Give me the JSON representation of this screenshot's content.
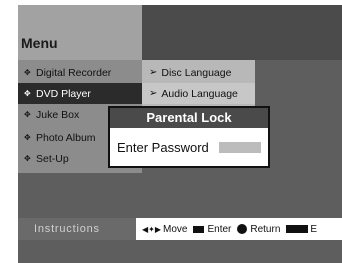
{
  "header": {
    "title": "Menu"
  },
  "menu": {
    "items": [
      {
        "label": "Digital Recorder",
        "active": false
      },
      {
        "label": "DVD Player",
        "active": true
      },
      {
        "label": "Juke Box",
        "active": false
      },
      {
        "label": "Photo Album",
        "active": false
      },
      {
        "label": "Set-Up",
        "active": false
      }
    ],
    "sub_items": [
      {
        "label": "Disc Language"
      },
      {
        "label": "Audio Language"
      }
    ]
  },
  "dialog": {
    "title": "Parental Lock",
    "field_label": "Enter Password",
    "password_value": ""
  },
  "instructions": {
    "label": "Instructions",
    "move": "Move",
    "enter": "Enter",
    "return": "Return",
    "exit": "E"
  },
  "icons": {
    "bullet": "diamond-cross-icon",
    "submenu_arrow": "right-arrow-icon",
    "move": "four-way-arrow-icon",
    "enter": "enter-key-icon",
    "return": "return-circle-icon",
    "menu": "menu-key-icon"
  },
  "colors": {
    "active_item_bg": "#2b2b2b",
    "dialog_title_bg": "#4a4a4a",
    "screen_bg": "#5e5e5e"
  }
}
